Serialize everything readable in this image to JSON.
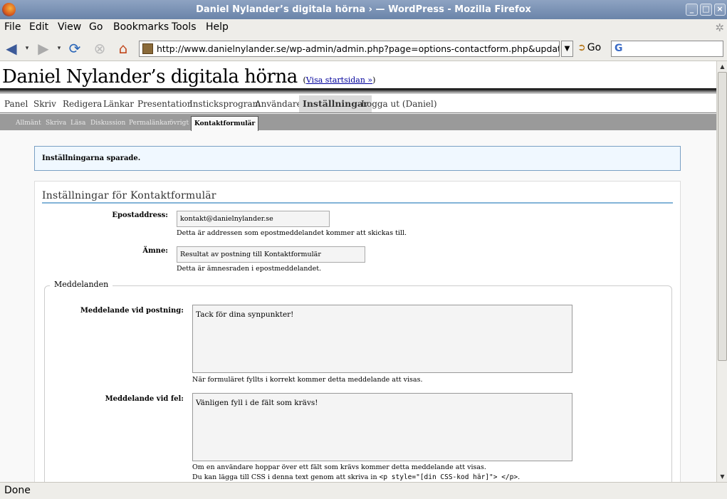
{
  "window": {
    "title": "Daniel Nylander’s digitala hörna › — WordPress - Mozilla Firefox"
  },
  "menu": [
    "File",
    "Edit",
    "View",
    "Go",
    "Bookmarks",
    "Tools",
    "Help"
  ],
  "nav": {
    "url": "http://www.danielnylander.se/wp-admin/admin.php?page=options-contactform.php&updated=true",
    "go_label": "Go",
    "search_value": ""
  },
  "status": "Done",
  "blog": {
    "title": "Daniel Nylander’s digitala hörna",
    "visit_link": "Visa startsidan »"
  },
  "admin_menu": [
    "Panel",
    "Skriv",
    "Redigera",
    "Länkar",
    "Presentation",
    "Insticksprogram",
    "Användare",
    "Inställningar",
    "Logga ut (Daniel)"
  ],
  "admin_menu_active": "Inställningar",
  "sub_menu": [
    "Allmänt",
    "Skriva",
    "Läsa",
    "Diskussion",
    "Permalänkar",
    "övrigt",
    "Kontaktformulär"
  ],
  "sub_menu_active": "Kontaktformulär",
  "notice": "Inställningarna sparade.",
  "form": {
    "heading": "Inställningar för Kontaktformulär",
    "email": {
      "label": "Epostaddress:",
      "value": "kontakt@danielnylander.se",
      "help": "Detta är addressen som epostmeddelandet kommer att skickas till."
    },
    "subject": {
      "label": "Ämne:",
      "value": "Resultat av postning till Kontaktformulär",
      "help": "Detta är ämnesraden i epostmeddelandet."
    },
    "messages": {
      "legend": "Meddelanden",
      "success": {
        "label": "Meddelande vid postning:",
        "value": "Tack för dina synpunkter!",
        "help": "När formuläret fyllts i korrekt kommer detta meddelande att visas."
      },
      "error": {
        "label": "Meddelande vid fel:",
        "value": "Vänligen fyll i de fält som krävs!",
        "help": "Om en användare hoppar över ett fält som krävs kommer detta meddelande att visas.",
        "css_help_prefix": "Du kan lägga till CSS i denna text genom att skriva in",
        "css_help_code": "<p style=\"[din CSS-kod här]\"> </p>",
        "css_help_suffix": "."
      }
    }
  },
  "colors": {
    "titlebar": "#7b93b6",
    "notice_border": "#7aa0c4",
    "heading_rule": "#83b4d8",
    "submenu_bg": "#9a9a9a"
  }
}
